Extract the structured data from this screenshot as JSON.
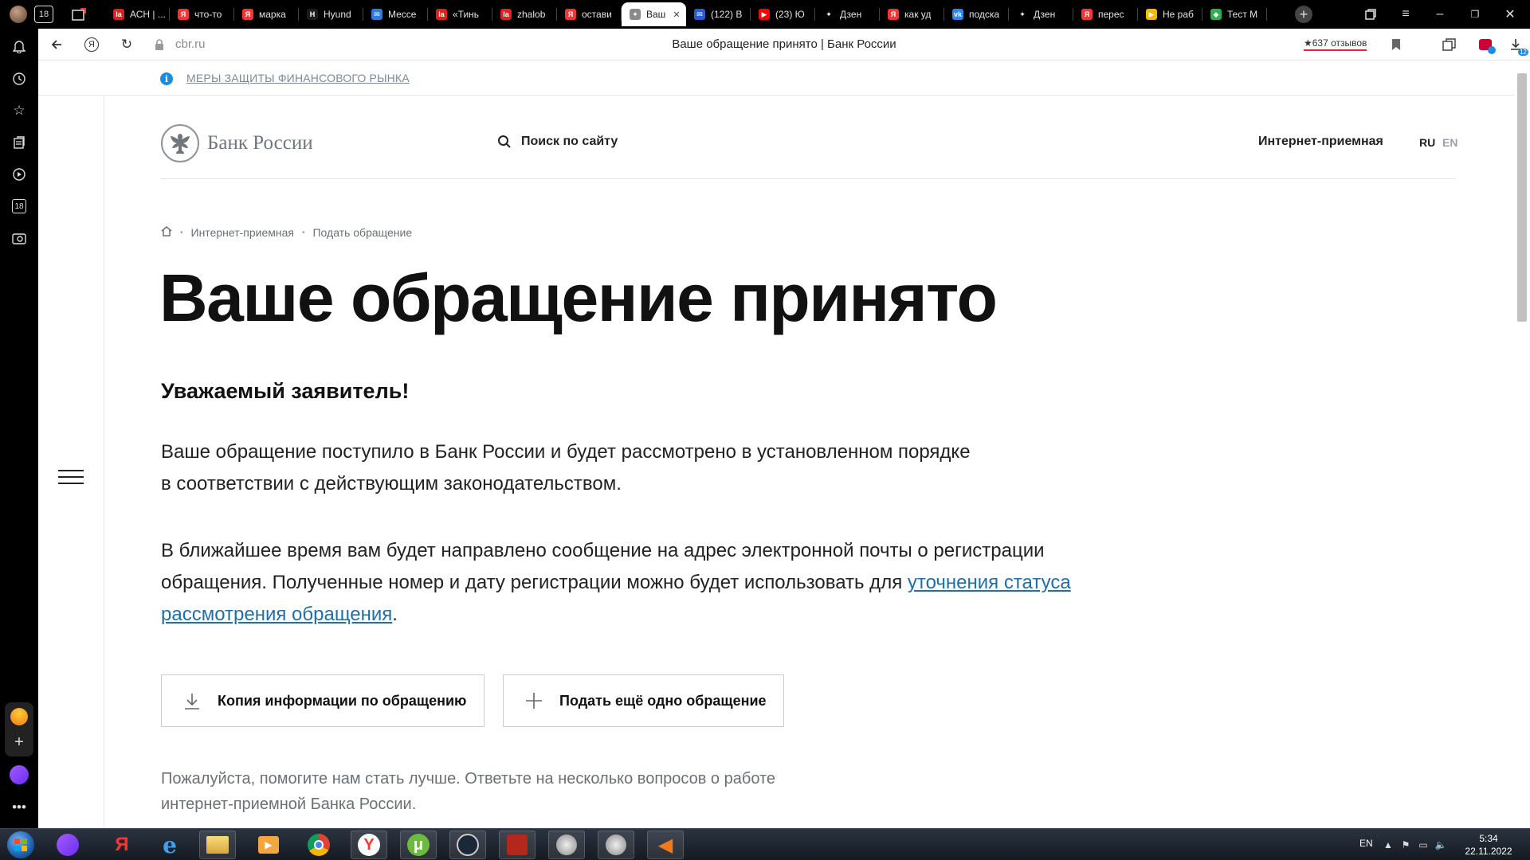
{
  "browser": {
    "tabs": [
      {
        "label": "АСН | ...",
        "icon": "la-icon",
        "color": "#e02020"
      },
      {
        "label": "что-то",
        "icon": "yandex-icon",
        "color": "#f33"
      },
      {
        "label": "марка",
        "icon": "yandex-icon",
        "color": "#f33"
      },
      {
        "label": "Hyund",
        "icon": "hyundai-icon",
        "color": "#1c1c1c"
      },
      {
        "label": "Мессе",
        "icon": "messenger-icon",
        "color": "#2a7de1"
      },
      {
        "label": "«Тинь",
        "icon": "la-icon",
        "color": "#e02020"
      },
      {
        "label": "zhalob",
        "icon": "la-icon",
        "color": "#e02020"
      },
      {
        "label": "остави",
        "icon": "yandex-icon",
        "color": "#f33"
      },
      {
        "label": "Ваш",
        "icon": "cbr-icon",
        "color": "#8a8a8a",
        "active": true
      },
      {
        "label": "(122) В",
        "icon": "mail-icon",
        "color": "#2a5bd7"
      },
      {
        "label": "(23) Ю",
        "icon": "youtube-icon",
        "color": "#f00"
      },
      {
        "label": "Дзен",
        "icon": "dzen-icon",
        "color": "#000"
      },
      {
        "label": "как уд",
        "icon": "yandex-icon",
        "color": "#f33"
      },
      {
        "label": "подска",
        "icon": "vk-icon",
        "color": "#2787f5"
      },
      {
        "label": "Дзен",
        "icon": "dzen-icon",
        "color": "#000"
      },
      {
        "label": "перес",
        "icon": "yandex-icon",
        "color": "#f33"
      },
      {
        "label": "Не раб",
        "icon": "play-icon",
        "color": "#f5b800"
      },
      {
        "label": "Тест М",
        "icon": "shield-icon",
        "color": "#2bb24c"
      }
    ],
    "url": "cbr.ru",
    "page_title": "Ваше обращение принято | Банк России",
    "reviews": "★637 отзывов",
    "downloads_badge": "12"
  },
  "notice": {
    "icon": "i",
    "text": "МЕРЫ ЗАЩИТЫ ФИНАНСОВОГО РЫНКА"
  },
  "header": {
    "logo_text": "Банк России",
    "search_label": "Поиск по сайту",
    "reception": "Интернет-приемная",
    "lang_ru": "RU",
    "lang_en": "EN"
  },
  "breadcrumb": {
    "items": [
      "Интернет-приемная",
      "Подать обращение"
    ]
  },
  "content": {
    "title": "Ваше обращение принято",
    "greeting": "Уважаемый заявитель!",
    "para1_line1": "Ваше обращение поступило в Банк России и будет рассмотрено в установленном порядке",
    "para1_line2": "в соответствии с действующим законодательством.",
    "para2_text": "В ближайшее время вам будет направлено сообщение на адрес электронной почты о регистрации обращения. Полученные номер и дату регистрации можно будет использовать для ",
    "para2_link": "уточнения статуса рассмотрения обращения",
    "para2_end": ".",
    "btn_copy": "Копия информации по обращению",
    "btn_new": "Подать ещё одно обращение",
    "survey": "Пожалуйста, помогите нам стать лучше. Ответьте на несколько вопросов о работе интернет-приемной Банка России."
  },
  "taskbar": {
    "lang": "EN",
    "time": "5:34",
    "date": "22.11.2022"
  }
}
